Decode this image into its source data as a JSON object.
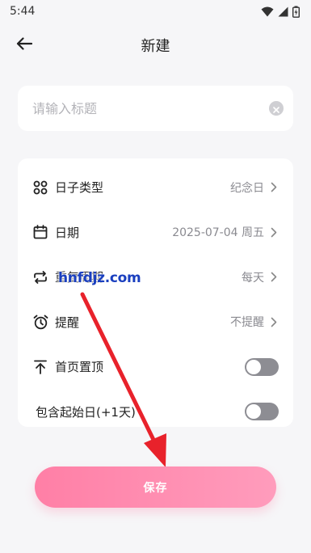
{
  "status_bar": {
    "time": "5:44",
    "icons": [
      "wifi-icon",
      "signal-icon",
      "battery-icon"
    ]
  },
  "header": {
    "title": "新建",
    "back_icon": "arrow-left-icon"
  },
  "title_input": {
    "placeholder": "请输入标题",
    "value": "",
    "clear_icon": "clear-circle-icon"
  },
  "settings": {
    "rows": [
      {
        "icon": "grid-icon",
        "label": "日子类型",
        "value": "纪念日"
      },
      {
        "icon": "calendar-icon",
        "label": "日期",
        "value": "2025-07-04 周五"
      },
      {
        "icon": "repeat-icon",
        "label": "重复周期",
        "value": "每天"
      },
      {
        "icon": "alarm-clock-icon",
        "label": "提醒",
        "value": "不提醒"
      }
    ],
    "pin_top": {
      "icon": "pin-top-icon",
      "label": "首页置顶",
      "on": false
    },
    "include_start": {
      "label": "包含起始日(+1天)",
      "on": false
    }
  },
  "watermark": "hnfdjz.com",
  "save_button": {
    "label": "保存"
  },
  "colors": {
    "accent_start": "#ff7fa6",
    "accent_end": "#ff9cbc",
    "toggle_off": "#8d8d93",
    "annotation_arrow": "#e8222b",
    "watermark": "#1a3fbf"
  }
}
